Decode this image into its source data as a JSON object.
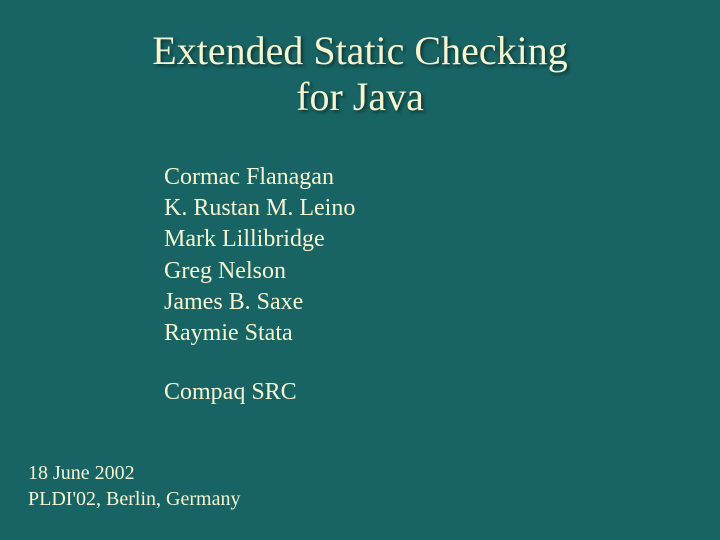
{
  "title": {
    "line1": "Extended Static Checking",
    "line2": "for Java"
  },
  "authors": [
    "Cormac Flanagan",
    "K. Rustan M. Leino",
    "Mark Lillibridge",
    "Greg Nelson",
    "James B. Saxe",
    "Raymie Stata"
  ],
  "affiliation": "Compaq SRC",
  "footer": {
    "date": "18 June 2002",
    "venue": "PLDI'02, Berlin, Germany"
  }
}
